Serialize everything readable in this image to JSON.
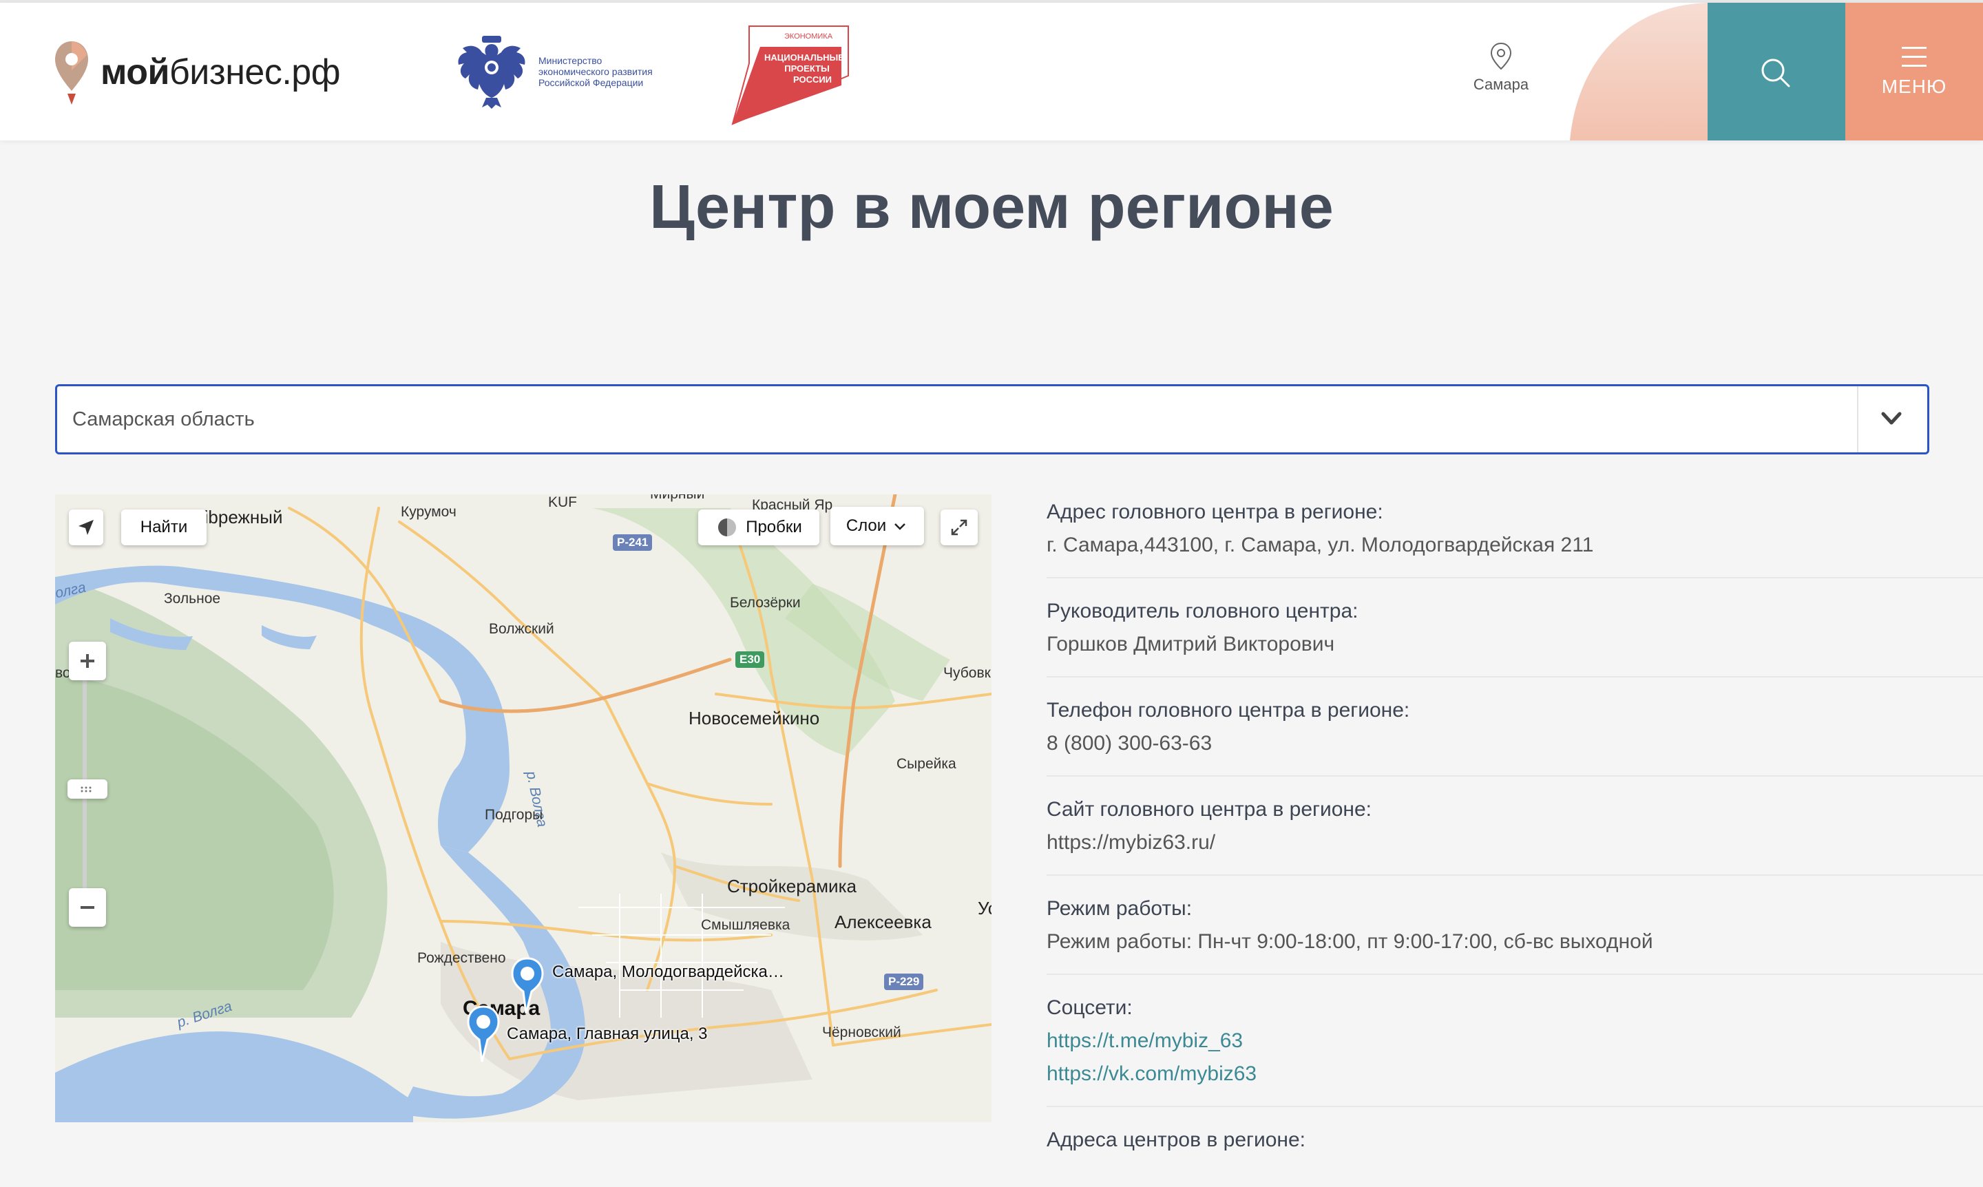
{
  "header": {
    "logo": {
      "bold": "мой",
      "regular": "бизнес.рф"
    },
    "ministry": {
      "line1": "Министерство",
      "line2": "экономического развития",
      "line3": "Российской Федерации"
    },
    "national_projects": {
      "top": "ЭКОНОМИКА",
      "line1": "НАЦИОНАЛЬНЫЕ",
      "line2": "ПРОЕКТЫ",
      "line3": "РОССИИ"
    },
    "region": "Самара",
    "menu_label": "МЕНЮ"
  },
  "page_title": "Центр в моем регионе",
  "region_select": {
    "value": "Самарская область"
  },
  "map": {
    "controls": {
      "find": "Найти",
      "traffic": "Пробки",
      "layers": "Слои"
    },
    "labels": {
      "pribrezhny": "ribрежный",
      "kurumoch": "Курумоч",
      "kuf": "KUF",
      "mirny": "Мирный",
      "krasny_yar": "Красный Яр",
      "zolnoe": "Зольное",
      "volga_top": "олга",
      "volzhsky": "Волжский",
      "belozerki": "Белозёрки",
      "chubovka": "Чубовк",
      "novosemeykino": "Новосемейкино",
      "syreyka": "Сырейка",
      "r_volga": "р. Волга",
      "podgory": "Подгоры",
      "stroykeramika": "Стройкерамика",
      "smyshlyaevka": "Смышляевка",
      "alekseevka": "Алексеевка",
      "u": "Ус",
      "rozhdestveno": "Рождествено",
      "samara": "Самара",
      "r_volga2": "р. Волга",
      "chernovsky": "Чёрновский",
      "vo": "во"
    },
    "roads": {
      "r241": "Р-241",
      "e30": "E30",
      "r229": "Р-229"
    },
    "pins": [
      {
        "label": "Самара, Молодогвардейска…"
      },
      {
        "label": "Самара, Главная улица, 3"
      }
    ]
  },
  "info": {
    "address": {
      "label": "Адрес головного центра в регионе:",
      "value": "г. Самара,443100, г. Самара, ул. Молодогвардейская 211"
    },
    "head": {
      "label": "Руководитель головного центра:",
      "value": "Горшков Дмитрий Викторович"
    },
    "phone": {
      "label": "Телефон головного центра в регионе:",
      "value": "8 (800) 300-63-63"
    },
    "site": {
      "label": "Сайт головного центра в регионе:",
      "value": "https://mybiz63.ru/"
    },
    "hours": {
      "label": "Режим работы:",
      "value": "Режим работы: Пн-чт 9:00-18:00, пт 9:00-17:00, сб-вс выходной"
    },
    "social": {
      "label": "Соцсети:",
      "links": [
        "https://t.me/mybiz_63",
        "https://vk.com/mybiz63"
      ]
    },
    "centers": {
      "label": "Адреса центров в регионе:"
    }
  },
  "colors": {
    "accent_teal": "#4b9aa3",
    "accent_peach": "#ef9c7e",
    "select_border": "#2b55c7",
    "link": "#3b8a93"
  }
}
